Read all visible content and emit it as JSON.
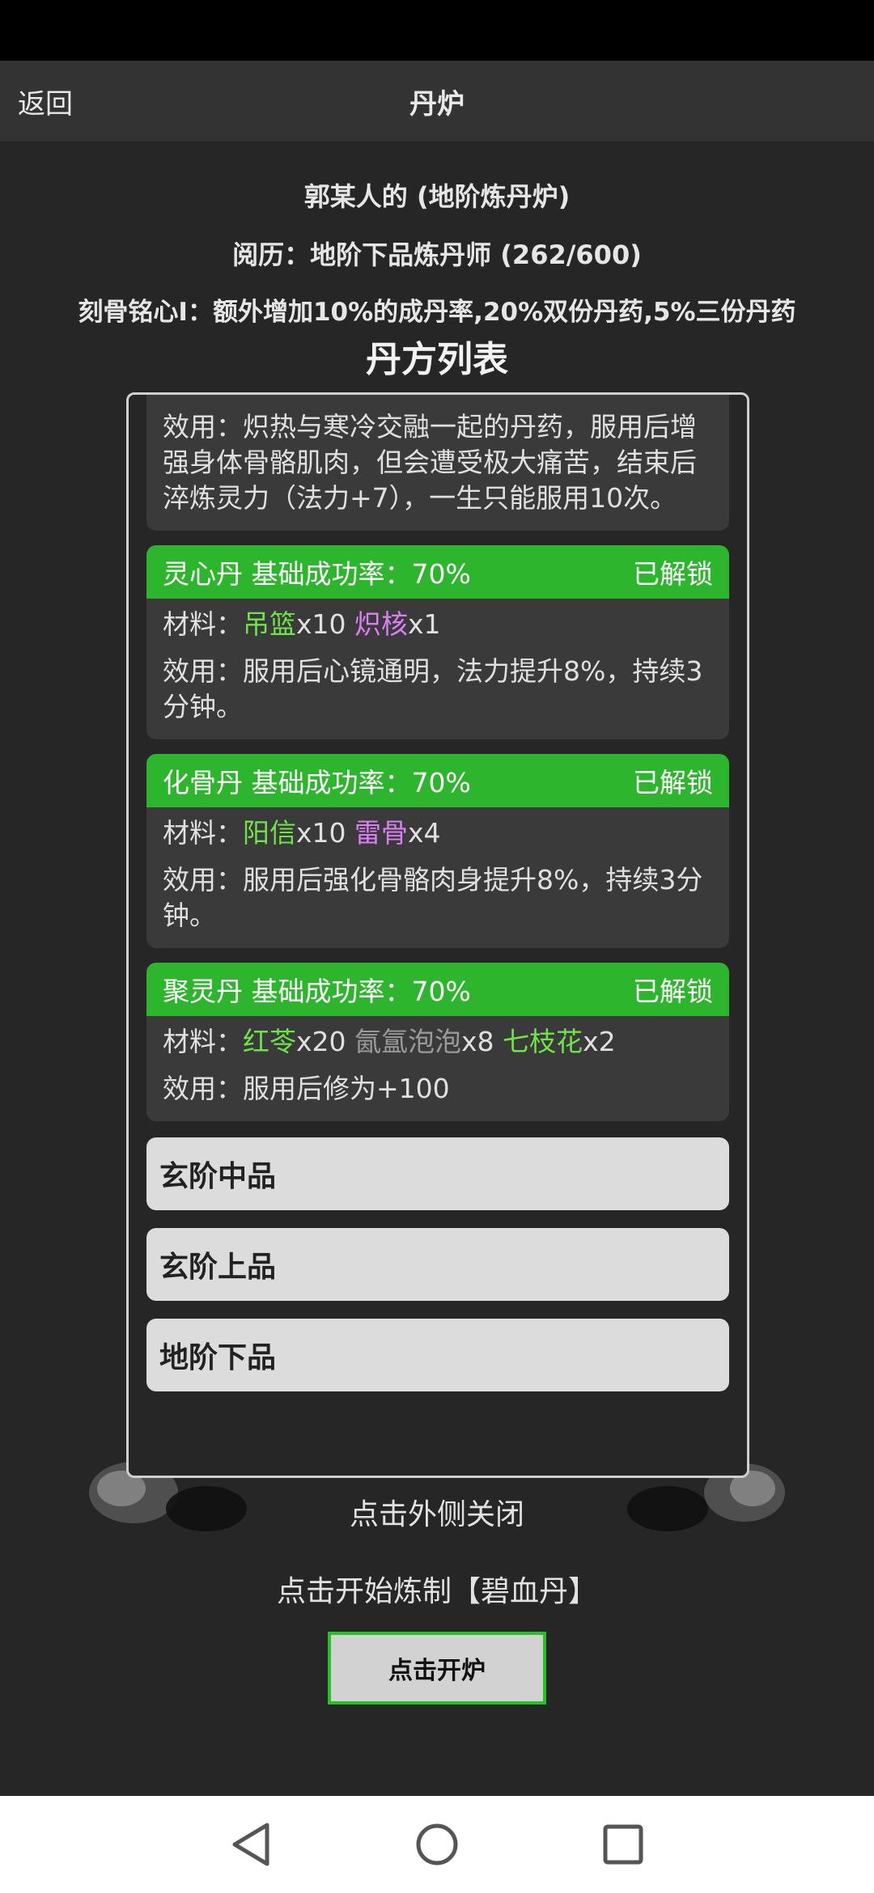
{
  "header": {
    "back_label": "返回",
    "title": "丹炉"
  },
  "furnace": {
    "owner_line": "郭某人的 (地阶炼丹炉)",
    "experience_line": "阅历：地阶下品炼丹师 (262/600)",
    "talent_line": "刻骨铭心I：额外增加10%的成丹率,20%双份丹药,5%三份丹药"
  },
  "recipe_list": {
    "title": "丹方列表",
    "partial_effect": "效用：炽热与寒冷交融一起的丹药，服用后增强身体骨骼肌肉，但会遭受极大痛苦，结束后淬炼灵力（法力+7），一生只能服用10次。",
    "recipes": [
      {
        "name_rate": "灵心丹 基础成功率：70%",
        "status": "已解锁",
        "materials_label": "材料：",
        "materials": [
          {
            "name": "吊篮",
            "qty": "x10",
            "color": "#6fe34a"
          },
          {
            "name": "炽核",
            "qty": "x1",
            "color": "#dc7ff5"
          }
        ],
        "effect": "效用：服用后心镜通明，法力提升8%，持续3分钟。"
      },
      {
        "name_rate": "化骨丹 基础成功率：70%",
        "status": "已解锁",
        "materials_label": "材料：",
        "materials": [
          {
            "name": "阳信",
            "qty": "x10",
            "color": "#6fe34a"
          },
          {
            "name": "雷骨",
            "qty": "x4",
            "color": "#dc7ff5"
          }
        ],
        "effect": "效用：服用后强化骨骼肉身提升8%，持续3分钟。"
      },
      {
        "name_rate": "聚灵丹 基础成功率：70%",
        "status": "已解锁",
        "materials_label": "材料：",
        "materials": [
          {
            "name": "红苓",
            "qty": "x20",
            "color": "#6fe34a"
          },
          {
            "name": "氤氲泡泡",
            "qty": "x8",
            "color": "#9a9a9a"
          },
          {
            "name": "七枝花",
            "qty": "x2",
            "color": "#6fe34a"
          }
        ],
        "effect": "效用：服用后修为+100"
      }
    ],
    "tiers": [
      "玄阶中品",
      "玄阶上品",
      "地阶下品"
    ]
  },
  "footer": {
    "close_hint": "点击外侧关闭",
    "start_text": "点击开始炼制【碧血丹】",
    "open_button": "点击开炉"
  },
  "icons": {
    "nav_back": "triangle-back-icon",
    "nav_home": "circle-home-icon",
    "nav_recent": "square-recent-icon"
  },
  "colors": {
    "unlocked_header": "#2db52d",
    "material_common": "#6fe34a",
    "material_rare": "#dc7ff5",
    "material_gray": "#9a9a9a",
    "start_button_border": "#22c322"
  }
}
